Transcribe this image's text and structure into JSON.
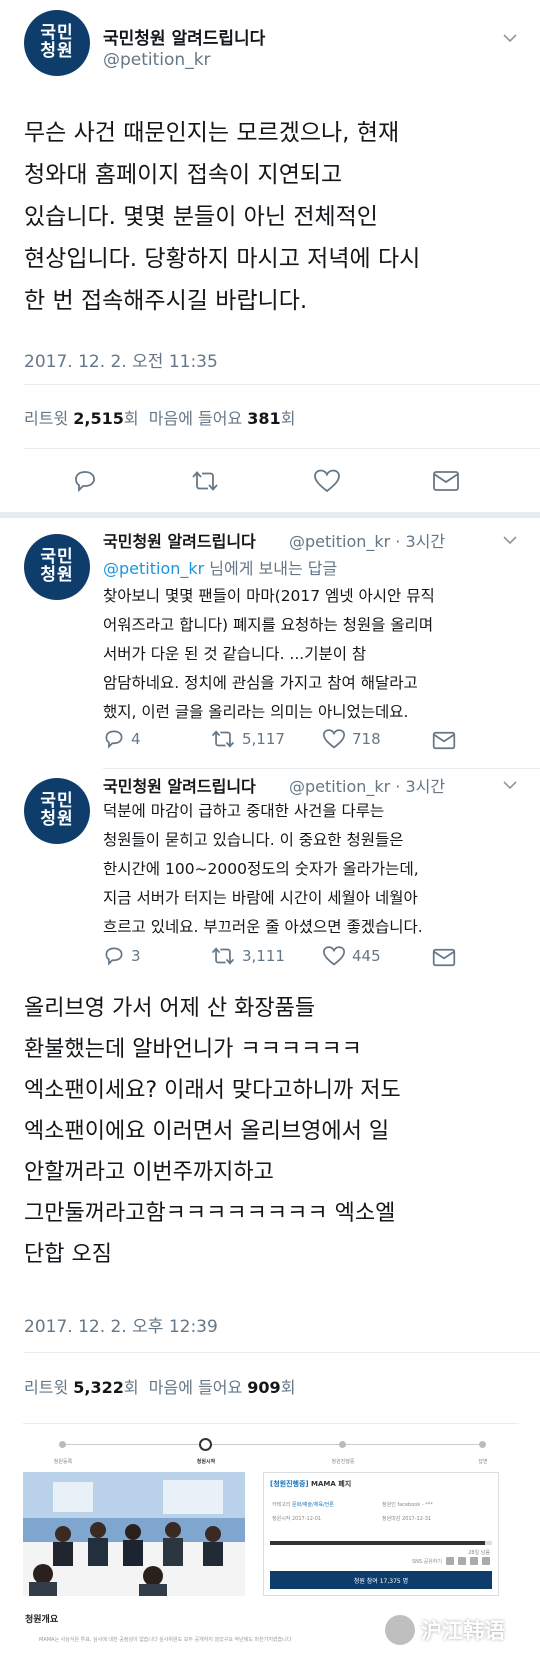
{
  "account": {
    "name": "국민청원 알려드립니다",
    "handle": "@petition_kr",
    "avatar_lines": [
      "국민",
      "청원"
    ]
  },
  "main_tweet": {
    "lines": [
      "무슨 사건 때문인지는 모르겠으나, 현재",
      "청와대 홈페이지 접속이 지연되고",
      "있습니다. 몇몇 분들이 아닌 전체적인",
      "현상입니다. 당황하지 마시고 저녁에 다시",
      "한 번 접속해주시길 바랍니다."
    ],
    "timestamp": "2017. 12. 2. 오전 11:35",
    "retweets_label": "리트윗",
    "retweets": "2,515",
    "likes_label": "마음에 들어요",
    "likes": "381",
    "count_unit": "회"
  },
  "replies": [
    {
      "name": "국민청원 알려드립니다",
      "handle": "@petition_kr · 3시간",
      "reply_to_handle": "@petition_kr",
      "reply_to_suffix": " 님에게 보내는 답글",
      "lines": [
        "찾아보니 몇몇 팬들이 마마(2017 엠넷 아시안 뮤직",
        "어워즈라고 합니다) 폐지를 요청하는 청원을 올리며",
        "서버가 다운 된 것 같습니다. ...기분이 참",
        "암담하네요. 정치에 관심을 가지고 참여 해달라고",
        "했지, 이런 글을 올리라는 의미는 아니었는데요."
      ],
      "replies_count": "4",
      "retweets_count": "5,117",
      "likes_count": "718"
    },
    {
      "name": "국민청원 알려드립니다",
      "handle": "@petition_kr · 3시간",
      "lines": [
        "덕분에 마감이 급하고 중대한 사건을 다루는",
        "청원들이 묻히고 있습니다. 이 중요한 청원들은",
        "한시간에 100~2000정도의 숫자가 올라가는데,",
        "지금 서버가 터지는 바람에 시간이 세월아 네월아",
        "흐르고 있네요. 부끄러운 줄 아셨으면 좋겠습니다."
      ],
      "replies_count": "3",
      "retweets_count": "3,111",
      "likes_count": "445"
    }
  ],
  "quote_tweet": {
    "lines": [
      "올리브영 가서 어제 산 화장품들",
      "환불했는데 알바언니가 ㅋㅋㅋㅋㅋㅋ",
      "엑소팬이세요? 이래서 맞다고하니까 저도",
      "엑소팬이에요 이러면서 올리브영에서 일",
      "안할꺼라고 이번주까지하고",
      "그만둘꺼라고함ㅋㅋㅋㅋㅋㅋㅋㅋ 엑소엘",
      "단합 오짐"
    ],
    "timestamp": "2017. 12. 2. 오후 12:39",
    "retweets_label": "리트윗",
    "retweets": "5,322",
    "likes_label": "마음에 들어요",
    "likes": "909",
    "count_unit": "회"
  },
  "embed": {
    "steps": [
      "청원등록",
      "청원시작",
      "청원진행중",
      "청원종료",
      "답변"
    ],
    "active_step": 1,
    "card_status": "[청원진행중]",
    "card_title": "MAMA 폐지",
    "category_label": "카테고리",
    "category_value": "문화/예술/체육/언론",
    "author_label": "청원인",
    "author_value": "facebook - ***",
    "start_label": "청원시작",
    "start_value": "2017-12-01",
    "end_label": "청원마감",
    "end_value": "2017-12-31",
    "progress": 0.97,
    "days_left": "28일 남음",
    "sns_label": "SNS 공유하기",
    "vote_button": "청원 참여 17,375 명",
    "overview_title": "청원개요",
    "overview_text": "MAMA는 사상식은 투표, 심사에 대한 공정성이 없습니다 심사위원도 모두 공개하지 않았구요 작년에도 마찬가지였습니다"
  },
  "watermark": "沪江韩语"
}
